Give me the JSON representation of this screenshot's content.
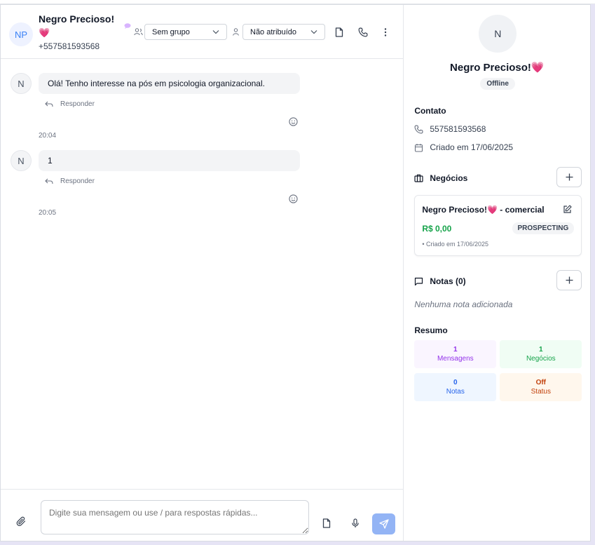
{
  "header": {
    "avatar_initials": "NP",
    "contact_name": "Negro Precioso!",
    "contact_heart": "💗",
    "contact_phone": "+557581593568",
    "group_select": "Sem grupo",
    "assign_select": "Não atribuído"
  },
  "messages": [
    {
      "avatar": "N",
      "text": "Olá! Tenho interesse na pós em psicologia organizacional.",
      "reply_label": "Responder",
      "time": "20:04"
    },
    {
      "avatar": "N",
      "text": "1",
      "reply_label": "Responder",
      "time": "20:05"
    }
  ],
  "composer": {
    "placeholder": "Digite sua mensagem ou use / para respostas rápidas..."
  },
  "side": {
    "avatar_initial": "N",
    "name": "Negro Precioso!💗",
    "status": "Offline",
    "contact_title": "Contato",
    "phone": "557581593568",
    "created": "Criado em 17/06/2025",
    "deals_title": "Negócios",
    "deal": {
      "title": "Negro Precioso!💗  - comercial",
      "value": "R$ 0,00",
      "stage": "PROSPECTING",
      "created": "• Criado em 17/06/2025"
    },
    "notes_title": "Notas (0)",
    "notes_empty": "Nenhuma nota adicionada",
    "summary_title": "Resumo",
    "summary": [
      {
        "value": "1",
        "label": "Mensagens",
        "bg": "#faf5ff",
        "color": "#9333ea"
      },
      {
        "value": "1",
        "label": "Negócios",
        "bg": "#f0fdf4",
        "color": "#16a34a"
      },
      {
        "value": "0",
        "label": "Notas",
        "bg": "#eff6ff",
        "color": "#2563eb"
      },
      {
        "value": "Off",
        "label": "Status",
        "bg": "#fff7ed",
        "color": "#c2410c"
      }
    ]
  },
  "colors": {
    "accent": "#3b82f6",
    "send_button": "#93b4f5",
    "deal_value": "#16a34a"
  }
}
